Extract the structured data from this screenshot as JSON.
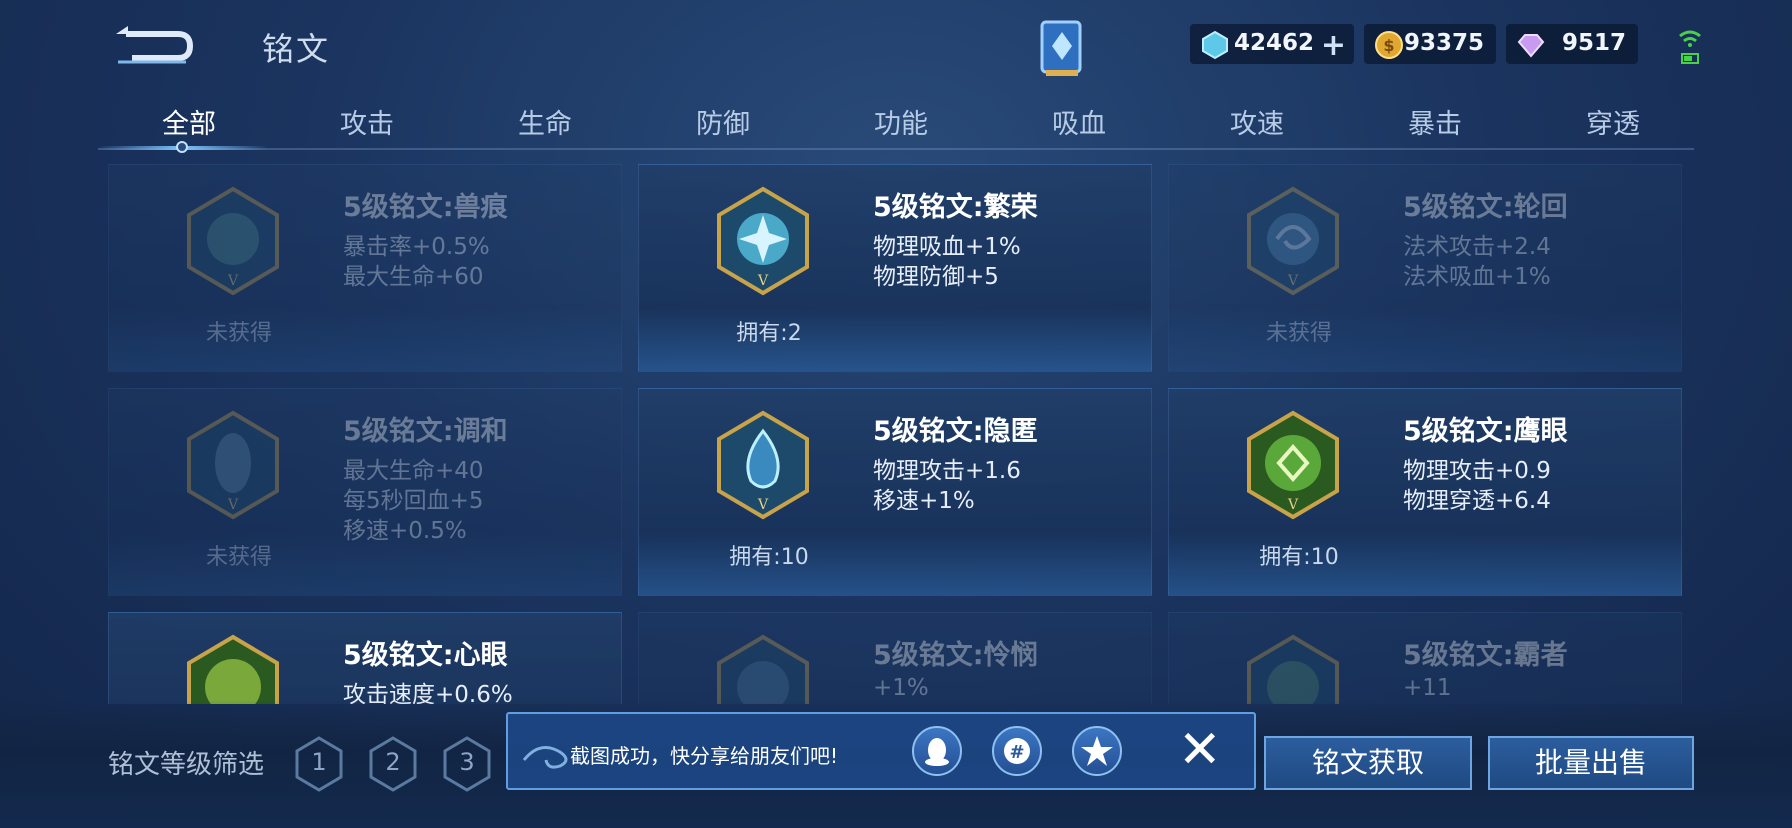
{
  "header": {
    "title": "铭文",
    "currencies": {
      "diamond": "42462",
      "gold": "93375",
      "gem": "9517"
    }
  },
  "tabs": [
    "全部",
    "攻击",
    "生命",
    "防御",
    "功能",
    "吸血",
    "攻速",
    "暴击",
    "穿透"
  ],
  "active_tab": "全部",
  "cards": [
    {
      "name": "5级铭文:兽痕",
      "stats": [
        "暴击率+0.5%",
        "最大生命+60"
      ],
      "status": "未获得",
      "owned": false,
      "color": "#4a8a90"
    },
    {
      "name": "5级铭文:繁荣",
      "stats": [
        "物理吸血+1%",
        "物理防御+5"
      ],
      "status": "拥有:2",
      "owned": true,
      "color": "#4aa8c8"
    },
    {
      "name": "5级铭文:轮回",
      "stats": [
        "法术攻击+2.4",
        "法术吸血+1%"
      ],
      "status": "未获得",
      "owned": false,
      "color": "#4a8ab0"
    },
    {
      "name": "5级铭文:调和",
      "stats": [
        "最大生命+40",
        "每5秒回血+5",
        "移速+0.5%"
      ],
      "status": "未获得",
      "owned": false,
      "color": "#5a8aa8"
    },
    {
      "name": "5级铭文:隐匿",
      "stats": [
        "物理攻击+1.6",
        "移速+1%"
      ],
      "status": "拥有:10",
      "owned": true,
      "color": "#3a8ac0"
    },
    {
      "name": "5级铭文:鹰眼",
      "stats": [
        "物理攻击+0.9",
        "物理穿透+6.4"
      ],
      "status": "拥有:10",
      "owned": true,
      "color": "#5aa83a"
    },
    {
      "name": "5级铭文:心眼",
      "stats": [
        "攻击速度+0.6%"
      ],
      "status": "",
      "owned": true,
      "color": "#7aa83a"
    },
    {
      "name": "5级铭文:怜悯",
      "stats": [
        "+1%"
      ],
      "status": "",
      "owned": false,
      "color": "#4a7a9a"
    },
    {
      "name": "5级铭文:霸者",
      "stats": [
        "+11"
      ],
      "status": "",
      "owned": false,
      "color": "#4a8a70"
    }
  ],
  "bottom": {
    "filter_label": "铭文等级筛选",
    "levels": [
      "1",
      "2",
      "3"
    ],
    "toast_text": "截图成功，快分享给朋友们吧!",
    "obtain_label": "铭文获取",
    "sell_label": "批量出售"
  }
}
